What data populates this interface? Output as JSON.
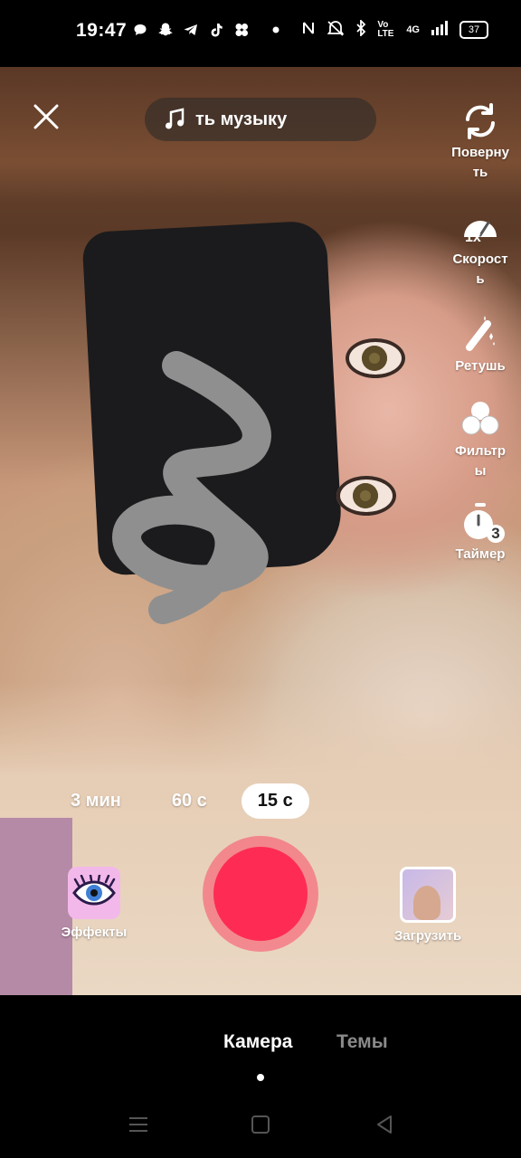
{
  "status_bar": {
    "time": "19:47",
    "network": "4G",
    "volte": "Vo LTE",
    "battery": "37",
    "icons": [
      "chat-icon",
      "snapchat-icon",
      "telegram-icon",
      "tiktok-icon",
      "dots-app-icon",
      "dot-icon",
      "nfc-icon",
      "mute-icon",
      "bluetooth-icon",
      "volte-icon",
      "signal-icon",
      "battery-icon"
    ]
  },
  "top": {
    "close_icon": "close-icon",
    "music_label": "ть музыку"
  },
  "side_tools": [
    {
      "icon": "flip-camera-icon",
      "label": "Поверну\nть"
    },
    {
      "icon": "speed-icon",
      "badge": "1x",
      "label": "Скорост\nь"
    },
    {
      "icon": "retouch-wand-icon",
      "label": "Ретушь"
    },
    {
      "icon": "filters-icon",
      "label": "Фильтр\nы"
    },
    {
      "icon": "timer-icon",
      "badge": "3",
      "label": "Таймер"
    }
  ],
  "durations": [
    {
      "label": "3 мин",
      "active": false
    },
    {
      "label": "60 с",
      "active": false
    },
    {
      "label": "15 с",
      "active": true
    }
  ],
  "effects_label": "Эффекты",
  "upload_label": "Загрузить",
  "modes": {
    "camera": "Камера",
    "themes": "Темы"
  },
  "colors": {
    "record": "#fe2c55",
    "inactive_tab": "#8a8a8a"
  },
  "nav_icons": [
    "menu-icon",
    "home-square-icon",
    "back-triangle-icon"
  ]
}
